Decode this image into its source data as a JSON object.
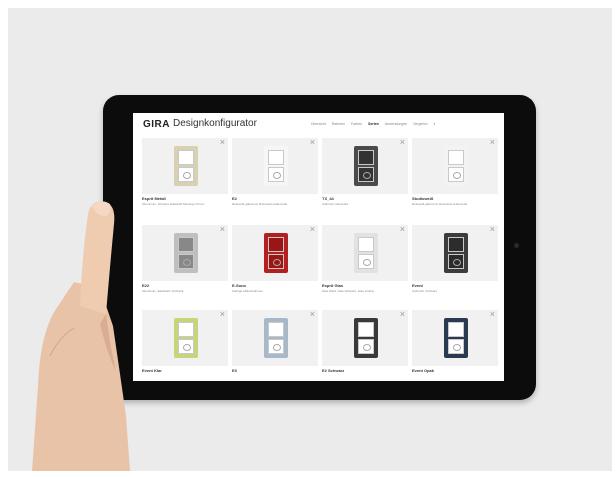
{
  "app": {
    "brand": "GIRA",
    "product": "Designkonfigurator"
  },
  "nav": [
    "Übersicht",
    "Rahmen",
    "Farben",
    "Serien",
    "Anwendungen",
    "Vergleich"
  ],
  "nav_active_index": 3,
  "nav_more": "›",
  "close_symbol": "×",
  "cards": [
    {
      "name": "Esprit Metall",
      "desc": "Aluminium, Schwarz Edelstahl Messing Chrom",
      "plate_color": "#d8d0b2",
      "inner": "#ffffff"
    },
    {
      "name": "E2",
      "desc": "Reinweiß glänzend, Reinweiß seidenmatt",
      "plate_color": "#f6f6f6",
      "inner": "#ffffff"
    },
    {
      "name": "TX_44",
      "desc": "Anthrazit, Reinweiß",
      "plate_color": "#4a4a4a",
      "inner": "#333333"
    },
    {
      "name": "Studioweiß",
      "desc": "Reinweiß glänzend, Reinweiß seidenmatt",
      "plate_color": "#f3f3f3",
      "inner": "#ffffff"
    },
    {
      "name": "E22",
      "desc": "Aluminium, Edelstahl, Anthrazit",
      "plate_color": "#bfbfbf",
      "inner": "#888888"
    },
    {
      "name": "E-Sono",
      "desc": "Farbige Abdeckrahmen",
      "plate_color": "#b3201f",
      "inner": "#9b1515"
    },
    {
      "name": "Esprit Glas",
      "desc": "Glas Weiß, Glas Schwarz, Glas Umbra",
      "plate_color": "#e2e2e2",
      "inner": "#ffffff"
    },
    {
      "name": "Event",
      "desc": "Anthrazit, Schwarz",
      "plate_color": "#3c3c3c",
      "inner": "#2c2c2c"
    },
    {
      "name": "Event Klar",
      "desc": "",
      "plate_color": "#c6d57a",
      "inner": "#ffffff"
    },
    {
      "name": "E3",
      "desc": "",
      "plate_color": "#a7b8c9",
      "inner": "#ffffff"
    },
    {
      "name": "E2 Schwarz",
      "desc": "",
      "plate_color": "#3a3a3a",
      "inner": "#ffffff"
    },
    {
      "name": "Event Opak",
      "desc": "",
      "plate_color": "#2a3a52",
      "inner": "#ffffff"
    }
  ],
  "colors": {
    "background": "#ebebeb",
    "tablet_bezel": "#0c0c0c",
    "screen": "#ffffff",
    "card_bg": "#f1f1f1",
    "skin": "#e9c3a8"
  }
}
